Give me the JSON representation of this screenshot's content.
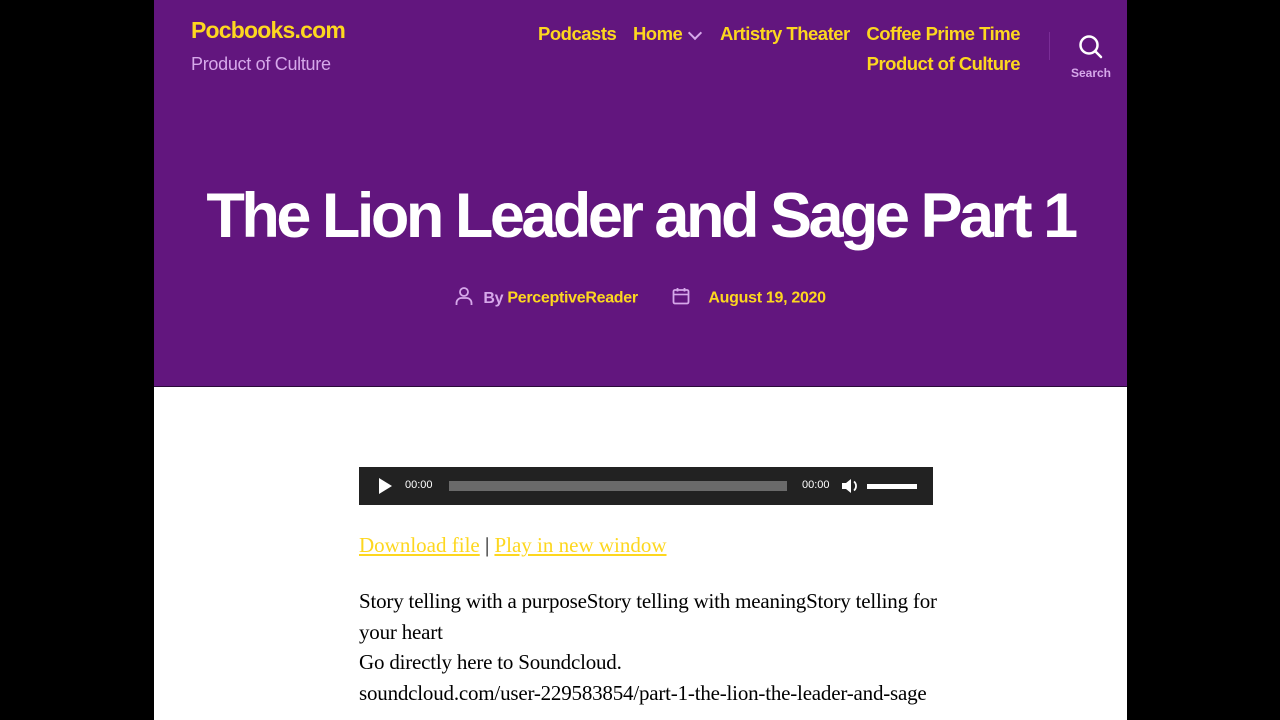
{
  "site": {
    "title": "Pocbooks.com",
    "description": "Product of Culture"
  },
  "nav": {
    "items": [
      {
        "label": "Podcasts"
      },
      {
        "label": "Home",
        "has_submenu": true
      },
      {
        "label": "Artistry Theater"
      },
      {
        "label": "Coffee Prime Time"
      },
      {
        "label": "Product of Culture"
      }
    ],
    "search_label": "Search",
    "search_icon": "search-icon"
  },
  "post": {
    "title": "The Lion Leader and Sage Part 1",
    "by_label": "By",
    "author": "PerceptiveReader",
    "date": "August 19, 2020",
    "author_icon": "user-icon",
    "date_icon": "calendar-icon"
  },
  "player": {
    "current_time": "00:00",
    "duration": "00:00",
    "progress": 0,
    "volume": 1.0
  },
  "links": {
    "download": "Download file",
    "separator": "|",
    "play_new_window": "Play in new window"
  },
  "content": {
    "paragraph1": "Story telling with a purposeStory telling with meaningStory telling for your heart",
    "paragraph2": "Go directly here to Soundcloud.",
    "paragraph3": "soundcloud.com/user-229583854/part-1-the-lion-the-leader-and-sage"
  },
  "colors": {
    "hero_bg": "#62167e",
    "accent": "#fdd71f",
    "muted": "#d6a8ea",
    "player_bg": "#222222"
  }
}
